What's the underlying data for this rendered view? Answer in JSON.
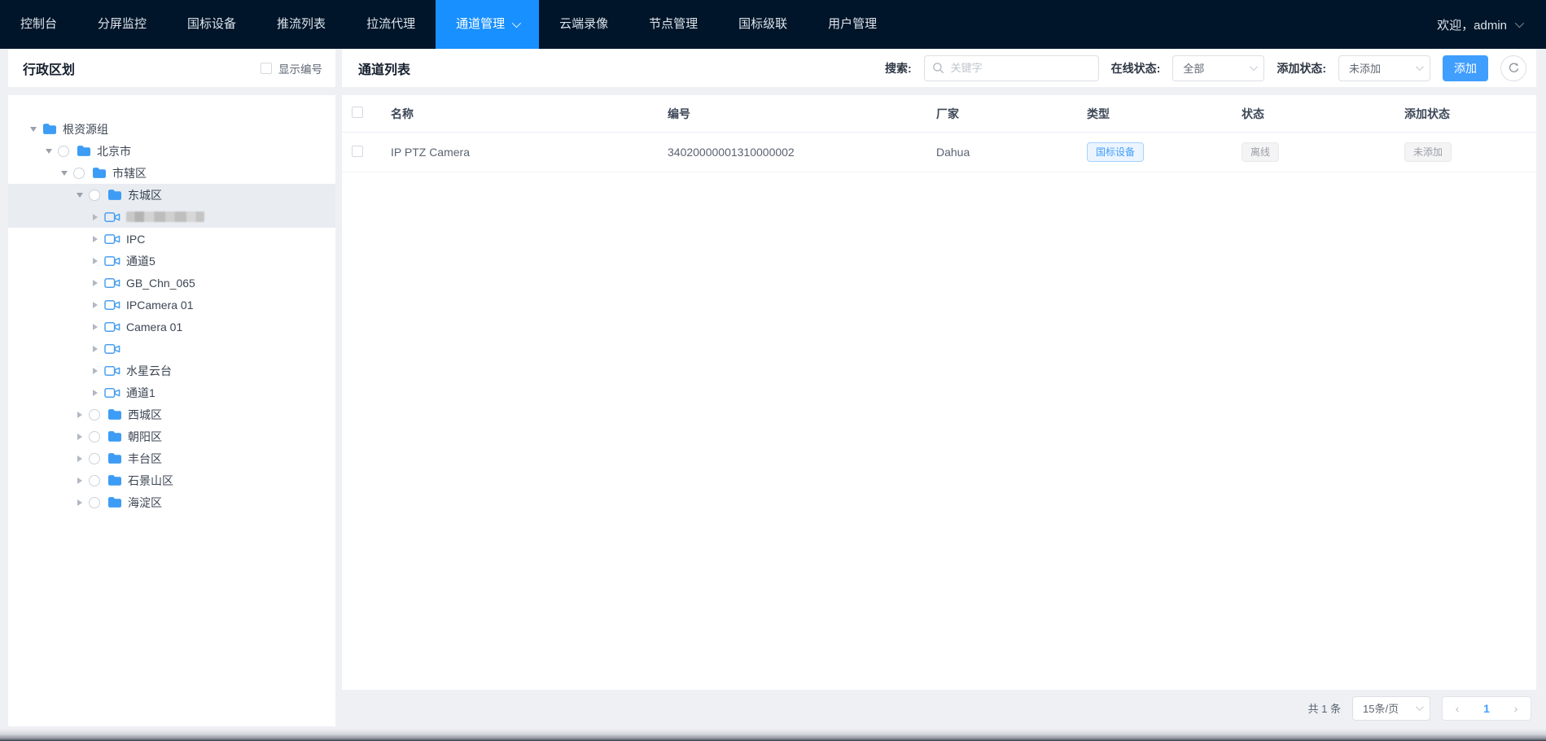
{
  "nav": {
    "items": [
      {
        "label": "控制台",
        "active": false,
        "dropdown": false
      },
      {
        "label": "分屏监控",
        "active": false,
        "dropdown": false
      },
      {
        "label": "国标设备",
        "active": false,
        "dropdown": false
      },
      {
        "label": "推流列表",
        "active": false,
        "dropdown": false
      },
      {
        "label": "拉流代理",
        "active": false,
        "dropdown": false
      },
      {
        "label": "通道管理",
        "active": true,
        "dropdown": true
      },
      {
        "label": "云端录像",
        "active": false,
        "dropdown": false
      },
      {
        "label": "节点管理",
        "active": false,
        "dropdown": false
      },
      {
        "label": "国标级联",
        "active": false,
        "dropdown": false
      },
      {
        "label": "用户管理",
        "active": false,
        "dropdown": false
      }
    ],
    "user": "欢迎，admin"
  },
  "sidebar": {
    "title": "行政区划",
    "show_number_label": "显示编号",
    "tree": [
      {
        "label": "根资源组",
        "level": 0,
        "type": "folder",
        "expanded": true,
        "radio": false,
        "selected": false,
        "blurred": false
      },
      {
        "label": "北京市",
        "level": 1,
        "type": "folder",
        "expanded": true,
        "radio": true,
        "selected": false,
        "blurred": false
      },
      {
        "label": "市辖区",
        "level": 2,
        "type": "folder",
        "expanded": true,
        "radio": true,
        "selected": false,
        "blurred": false
      },
      {
        "label": "东城区",
        "level": 3,
        "type": "folder",
        "expanded": true,
        "radio": true,
        "selected": true,
        "blurred": false
      },
      {
        "label": "",
        "level": 4,
        "type": "camera",
        "expanded": false,
        "radio": false,
        "selected": true,
        "blurred": true
      },
      {
        "label": "IPC",
        "level": 4,
        "type": "camera",
        "expanded": false,
        "radio": false,
        "selected": false,
        "blurred": false
      },
      {
        "label": "通道5",
        "level": 4,
        "type": "camera",
        "expanded": false,
        "radio": false,
        "selected": false,
        "blurred": false
      },
      {
        "label": "GB_Chn_065",
        "level": 4,
        "type": "camera",
        "expanded": false,
        "radio": false,
        "selected": false,
        "blurred": false
      },
      {
        "label": "IPCamera 01",
        "level": 4,
        "type": "camera",
        "expanded": false,
        "radio": false,
        "selected": false,
        "blurred": false
      },
      {
        "label": "Camera 01",
        "level": 4,
        "type": "camera",
        "expanded": false,
        "radio": false,
        "selected": false,
        "blurred": false
      },
      {
        "label": "",
        "level": 4,
        "type": "camera",
        "expanded": false,
        "radio": false,
        "selected": false,
        "blurred": false
      },
      {
        "label": "水星云台",
        "level": 4,
        "type": "camera",
        "expanded": false,
        "radio": false,
        "selected": false,
        "blurred": false
      },
      {
        "label": "通道1",
        "level": 4,
        "type": "camera",
        "expanded": false,
        "radio": false,
        "selected": false,
        "blurred": false
      },
      {
        "label": "西城区",
        "level": 3,
        "type": "folder",
        "expanded": false,
        "radio": true,
        "selected": false,
        "blurred": false
      },
      {
        "label": "朝阳区",
        "level": 3,
        "type": "folder",
        "expanded": false,
        "radio": true,
        "selected": false,
        "blurred": false
      },
      {
        "label": "丰台区",
        "level": 3,
        "type": "folder",
        "expanded": false,
        "radio": true,
        "selected": false,
        "blurred": false
      },
      {
        "label": "石景山区",
        "level": 3,
        "type": "folder",
        "expanded": false,
        "radio": true,
        "selected": false,
        "blurred": false
      },
      {
        "label": "海淀区",
        "level": 3,
        "type": "folder",
        "expanded": false,
        "radio": true,
        "selected": false,
        "blurred": false
      }
    ]
  },
  "main": {
    "title": "通道列表",
    "toolbar": {
      "search_label": "搜索:",
      "search_placeholder": "关键字",
      "online_status_label": "在线状态:",
      "online_status_value": "全部",
      "add_status_label": "添加状态:",
      "add_status_value": "未添加",
      "add_button": "添加"
    },
    "table": {
      "columns": [
        "名称",
        "编号",
        "厂家",
        "类型",
        "状态",
        "添加状态"
      ],
      "rows": [
        {
          "name": "IP PTZ Camera",
          "code": "34020000001310000002",
          "vendor": "Dahua",
          "type": "国标设备",
          "status": "离线",
          "add_status": "未添加"
        }
      ]
    },
    "pagination": {
      "total": "共 1 条",
      "page_size": "15条/页",
      "current_page": "1"
    }
  },
  "colors": {
    "nav_bg": "#001529",
    "nav_active": "#1890ff",
    "accent_button": "#409eff",
    "selected_row_bg": "#e9edf2",
    "badge_blue_text": "#409eff",
    "badge_gray_text": "#909399"
  }
}
